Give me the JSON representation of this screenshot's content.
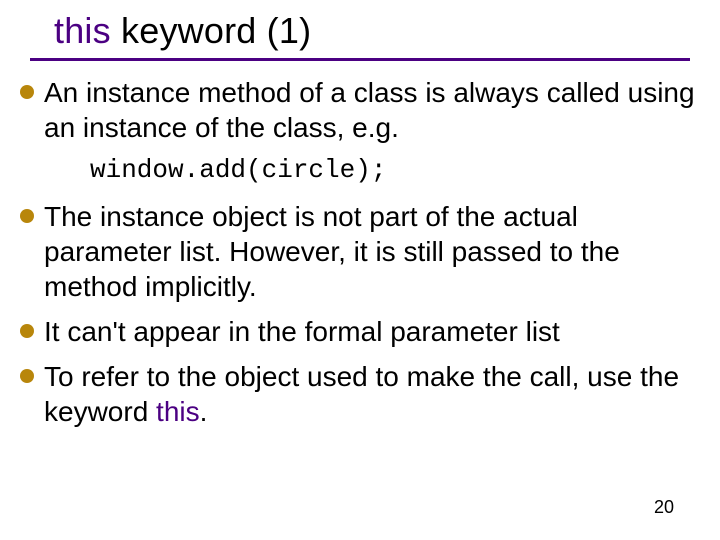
{
  "title": {
    "keyword": "this",
    "rest": " keyword (1)"
  },
  "bullets": [
    {
      "text": "An instance method of a class is always called using an instance of the class, e.g.",
      "code": "window.add(circle);"
    },
    {
      "text": "The instance object is not part of the actual parameter list. However, it is still passed to the method implicitly."
    },
    {
      "text": "It can't appear in the formal parameter list"
    },
    {
      "prefix": "To refer to the object used to make the call, use the keyword ",
      "keyword": "this",
      "suffix": "."
    }
  ],
  "page_number": "20",
  "colors": {
    "keyword": "#4b0082",
    "underline": "#4b0082",
    "bullet_dot": "#b8860b"
  }
}
